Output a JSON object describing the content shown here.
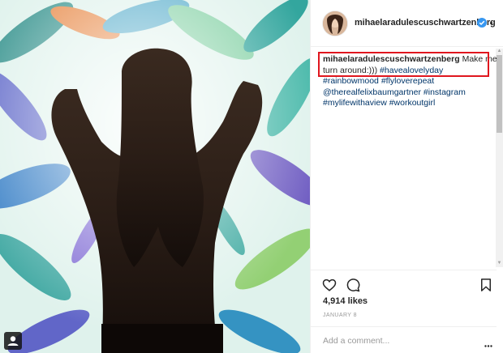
{
  "post": {
    "username": "mihaelaradulescuschwartzenberg",
    "caption": {
      "line1_text": " Make me",
      "line2_text": "turn around:)))",
      "hashtags": [
        "#havealovelyday",
        "#rainbowmood",
        "#flyloverepeat",
        "@therealfelixbaumgartner",
        "#instagram",
        "#mylifewithaview",
        "#workoutgirl"
      ]
    },
    "likes": "4,914 likes",
    "date": "JANUARY 8",
    "comment_placeholder": "Add a comment..."
  },
  "icons": {
    "verified": "verified-badge-icon",
    "like": "heart-outline-icon",
    "comment": "speech-bubble-icon",
    "save": "bookmark-icon",
    "tagged": "user-tag-icon"
  },
  "colors": {
    "highlight": "#e0161e",
    "link": "#003569",
    "verified": "#3897f0",
    "muted": "#999999"
  }
}
